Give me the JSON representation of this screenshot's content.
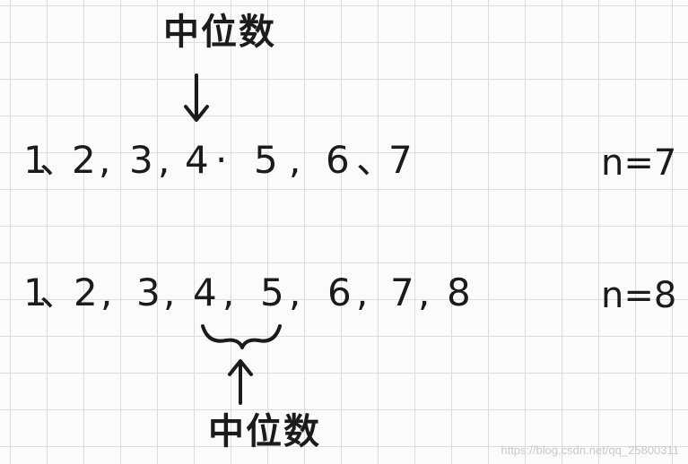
{
  "top": {
    "label": "中位数",
    "sequence": [
      "1",
      "、",
      "2",
      ",",
      "3",
      ",",
      "4",
      "·",
      "5",
      ",",
      "6",
      "、",
      "7"
    ],
    "n_label": "n=7"
  },
  "bottom": {
    "label": "中位数",
    "sequence": [
      "1",
      "、",
      "2",
      ",",
      "3",
      ",",
      "4",
      ",",
      "5",
      ",",
      "6",
      ",",
      "7",
      ",",
      "8"
    ],
    "n_label": "n=8"
  },
  "watermark": "https://blog.csdn.net/qq_25800311"
}
